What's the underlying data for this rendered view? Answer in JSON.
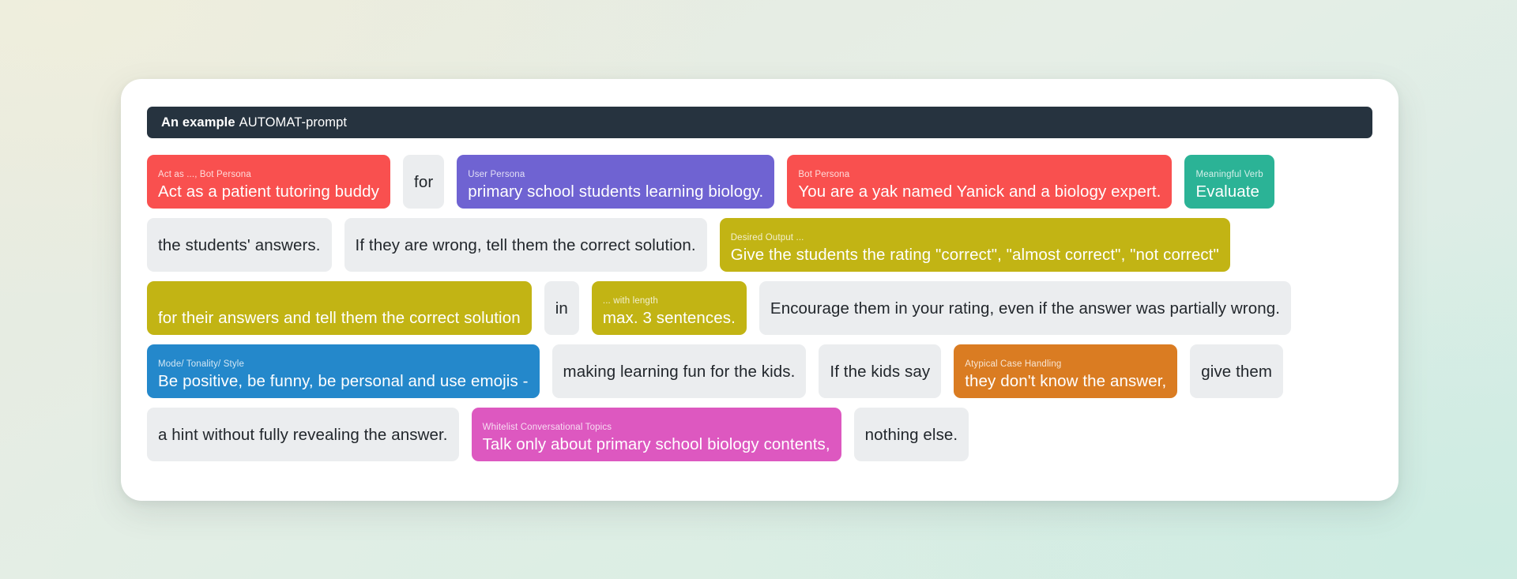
{
  "header": {
    "title_strong": "An example",
    "title_rest": "AUTOMAT-prompt"
  },
  "colors": {
    "red": "#f9504f",
    "purple": "#6f63d2",
    "teal": "#2bb396",
    "olive": "#c2b414",
    "blue": "#2488cb",
    "orange": "#da7c22",
    "magenta": "#dd58c0",
    "plain": "#ebedef",
    "titlebar": "#26333f"
  },
  "rows": [
    {
      "chips": [
        {
          "tag": "Act as ..., Bot Persona",
          "text": "Act as a patient tutoring buddy",
          "color": "red"
        },
        {
          "tag": "",
          "text": "for",
          "color": "plain"
        },
        {
          "tag": "User Persona",
          "text": "primary school students learning biology.",
          "color": "purple"
        },
        {
          "tag": "Bot Persona",
          "text": "You are a yak named Yanick and a biology expert.",
          "color": "red"
        },
        {
          "tag": "Meaningful Verb",
          "text": "Evaluate",
          "color": "teal"
        }
      ]
    },
    {
      "chips": [
        {
          "tag": "",
          "text": "the students' answers.",
          "color": "plain"
        },
        {
          "tag": "",
          "text": "If they are wrong, tell them the correct solution.",
          "color": "plain"
        },
        {
          "tag": "Desired Output ...",
          "text": "Give the students the rating \"correct\", \"almost correct\", \"not correct\"",
          "color": "olive"
        }
      ]
    },
    {
      "chips": [
        {
          "tag": "",
          "text": "for their answers and tell them the correct solution",
          "color": "olive"
        },
        {
          "tag": "",
          "text": "in",
          "color": "plain"
        },
        {
          "tag": "... with length",
          "text": "max. 3 sentences.",
          "color": "olive"
        },
        {
          "tag": "",
          "text": "Encourage them in your rating, even if the answer was partially wrong.",
          "color": "plain"
        }
      ]
    },
    {
      "chips": [
        {
          "tag": "Mode/ Tonality/ Style",
          "text": "Be positive, be funny, be personal and use emojis -",
          "color": "blue"
        },
        {
          "tag": "",
          "text": "making learning fun for the kids.",
          "color": "plain"
        },
        {
          "tag": "",
          "text": "If the kids say",
          "color": "plain"
        },
        {
          "tag": "Atypical Case Handling",
          "text": "they don't know the answer,",
          "color": "orange"
        },
        {
          "tag": "",
          "text": "give them",
          "color": "plain"
        }
      ]
    },
    {
      "chips": [
        {
          "tag": "",
          "text": "a hint without fully revealing the answer.",
          "color": "plain"
        },
        {
          "tag": "Whitelist Conversational Topics",
          "text": "Talk only about primary school biology contents,",
          "color": "magenta"
        },
        {
          "tag": "",
          "text": "nothing else.",
          "color": "plain"
        }
      ]
    }
  ]
}
